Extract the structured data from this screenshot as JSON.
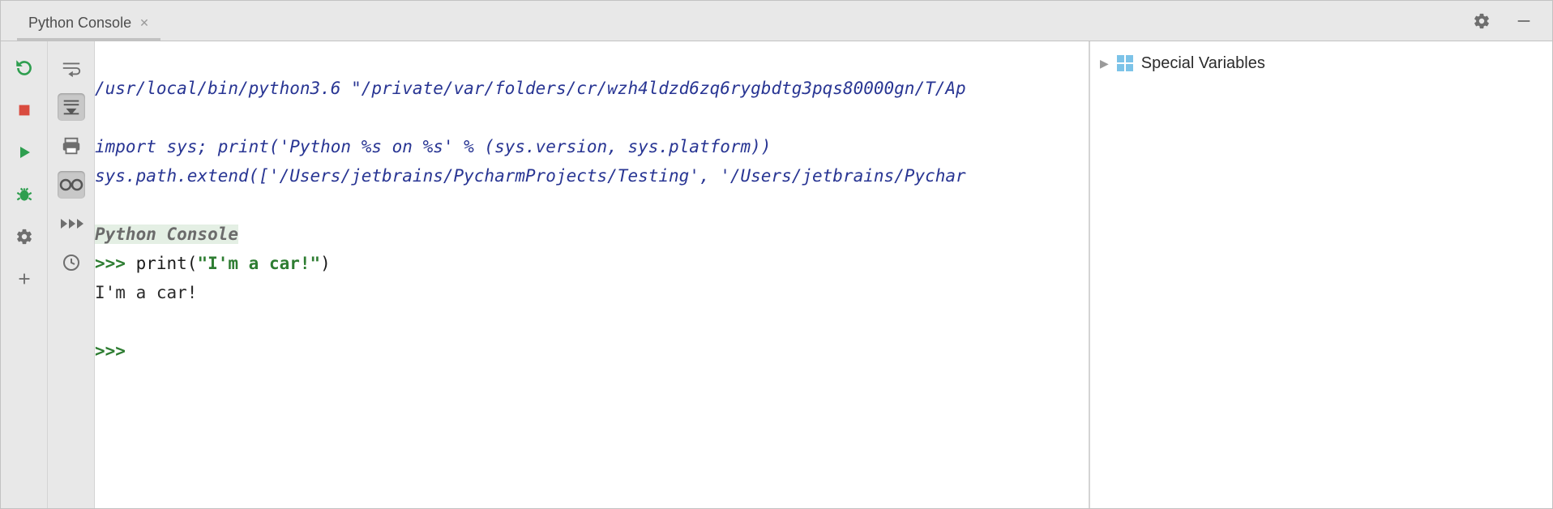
{
  "tab": {
    "title": "Python Console"
  },
  "header_icons": {
    "gear": "gear-icon",
    "minimize": "minimize-icon"
  },
  "left_toolbar": [
    {
      "name": "rerun-button",
      "title": "Rerun"
    },
    {
      "name": "stop-button",
      "title": "Stop"
    },
    {
      "name": "run-button",
      "title": "Run"
    },
    {
      "name": "debug-button",
      "title": "Debug"
    },
    {
      "name": "settings-button",
      "title": "Settings"
    },
    {
      "name": "add-button",
      "title": "Add"
    }
  ],
  "second_toolbar": [
    {
      "name": "soft-wrap-button",
      "title": "Soft-Wrap"
    },
    {
      "name": "scroll-to-end-button",
      "title": "Scroll to End",
      "pressed": true
    },
    {
      "name": "print-button",
      "title": "Print"
    },
    {
      "name": "show-vars-button",
      "title": "Show Variables",
      "pressed": true
    },
    {
      "name": "execute-selection-button",
      "title": "Execute"
    },
    {
      "name": "history-button",
      "title": "History"
    }
  ],
  "console": {
    "interpreter_line": "/usr/local/bin/python3.6 \"/private/var/folders/cr/wzh4ldzd6zq6rygbdtg3pqs80000gn/T/Ap",
    "import_line": "import sys; print('Python %s on %s' % (sys.version, sys.platform))",
    "syspath_line": "sys.path.extend(['/Users/jetbrains/PycharmProjects/Testing', '/Users/jetbrains/Pychar",
    "banner": "Python Console",
    "prompt1": ">>> ",
    "call": "print(",
    "str_literal": "\"I'm a car!\"",
    "call_close": ")",
    "output": "I'm a car!",
    "prompt2": ">>> "
  },
  "variables": {
    "special_label": "Special Variables"
  }
}
